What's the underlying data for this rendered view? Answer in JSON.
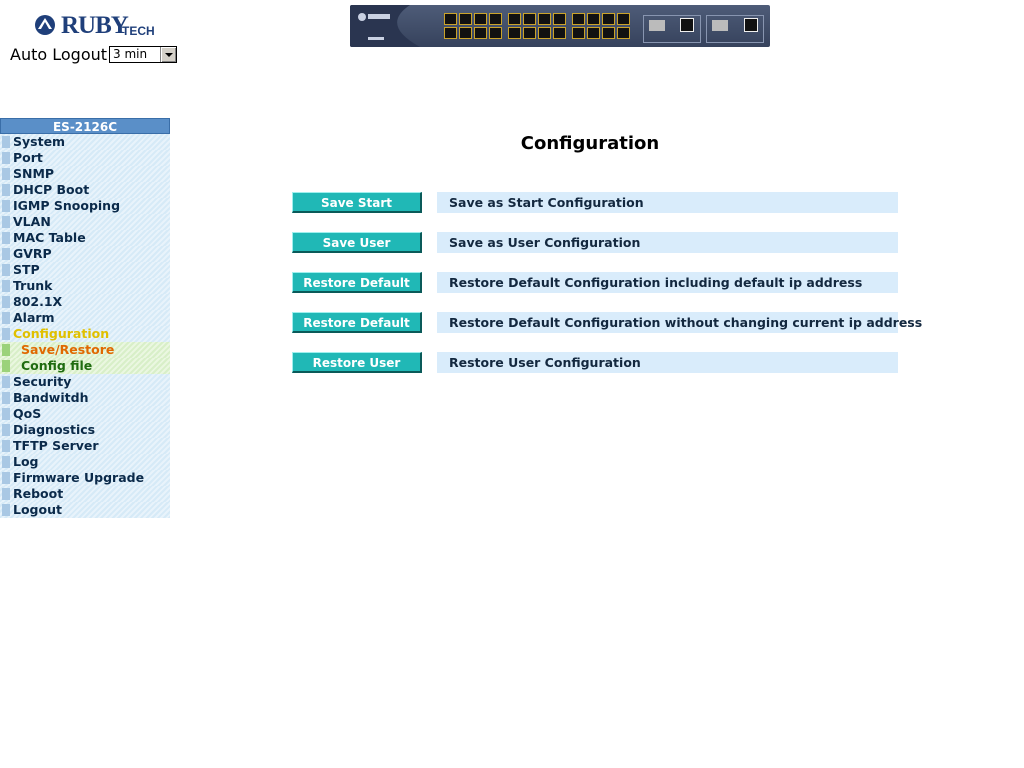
{
  "logo": {
    "brand": "RUBY",
    "brand_sub": "TECH"
  },
  "auto_logout": {
    "label": "Auto Logout",
    "selected": "3 min"
  },
  "sidebar": {
    "title": "ES-2126C",
    "items": [
      {
        "label": "System"
      },
      {
        "label": "Port"
      },
      {
        "label": "SNMP"
      },
      {
        "label": "DHCP Boot"
      },
      {
        "label": "IGMP Snooping"
      },
      {
        "label": "VLAN"
      },
      {
        "label": "MAC Table"
      },
      {
        "label": "GVRP"
      },
      {
        "label": "STP"
      },
      {
        "label": "Trunk"
      },
      {
        "label": "802.1X"
      },
      {
        "label": "Alarm"
      },
      {
        "label": "Configuration"
      },
      {
        "label": "Save/Restore"
      },
      {
        "label": "Config file"
      },
      {
        "label": "Security"
      },
      {
        "label": "Bandwitdh"
      },
      {
        "label": "QoS"
      },
      {
        "label": "Diagnostics"
      },
      {
        "label": "TFTP Server"
      },
      {
        "label": "Log"
      },
      {
        "label": "Firmware Upgrade"
      },
      {
        "label": "Reboot"
      },
      {
        "label": "Logout"
      }
    ]
  },
  "main": {
    "title": "Configuration",
    "actions": [
      {
        "button": "Save Start",
        "description": "Save as Start Configuration"
      },
      {
        "button": "Save User",
        "description": "Save as User Configuration"
      },
      {
        "button": "Restore Default",
        "description": "Restore Default Configuration including default ip address"
      },
      {
        "button": "Restore Default",
        "description": "Restore Default Configuration without changing current ip address"
      },
      {
        "button": "Restore User",
        "description": "Restore User Configuration"
      }
    ]
  },
  "colors": {
    "button_bg": "#20b8b6",
    "desc_bg": "#d9ecfb",
    "sidebar_header": "#5a8fc8",
    "active_item": "#e0c000",
    "selected_subitem": "#e06800"
  }
}
